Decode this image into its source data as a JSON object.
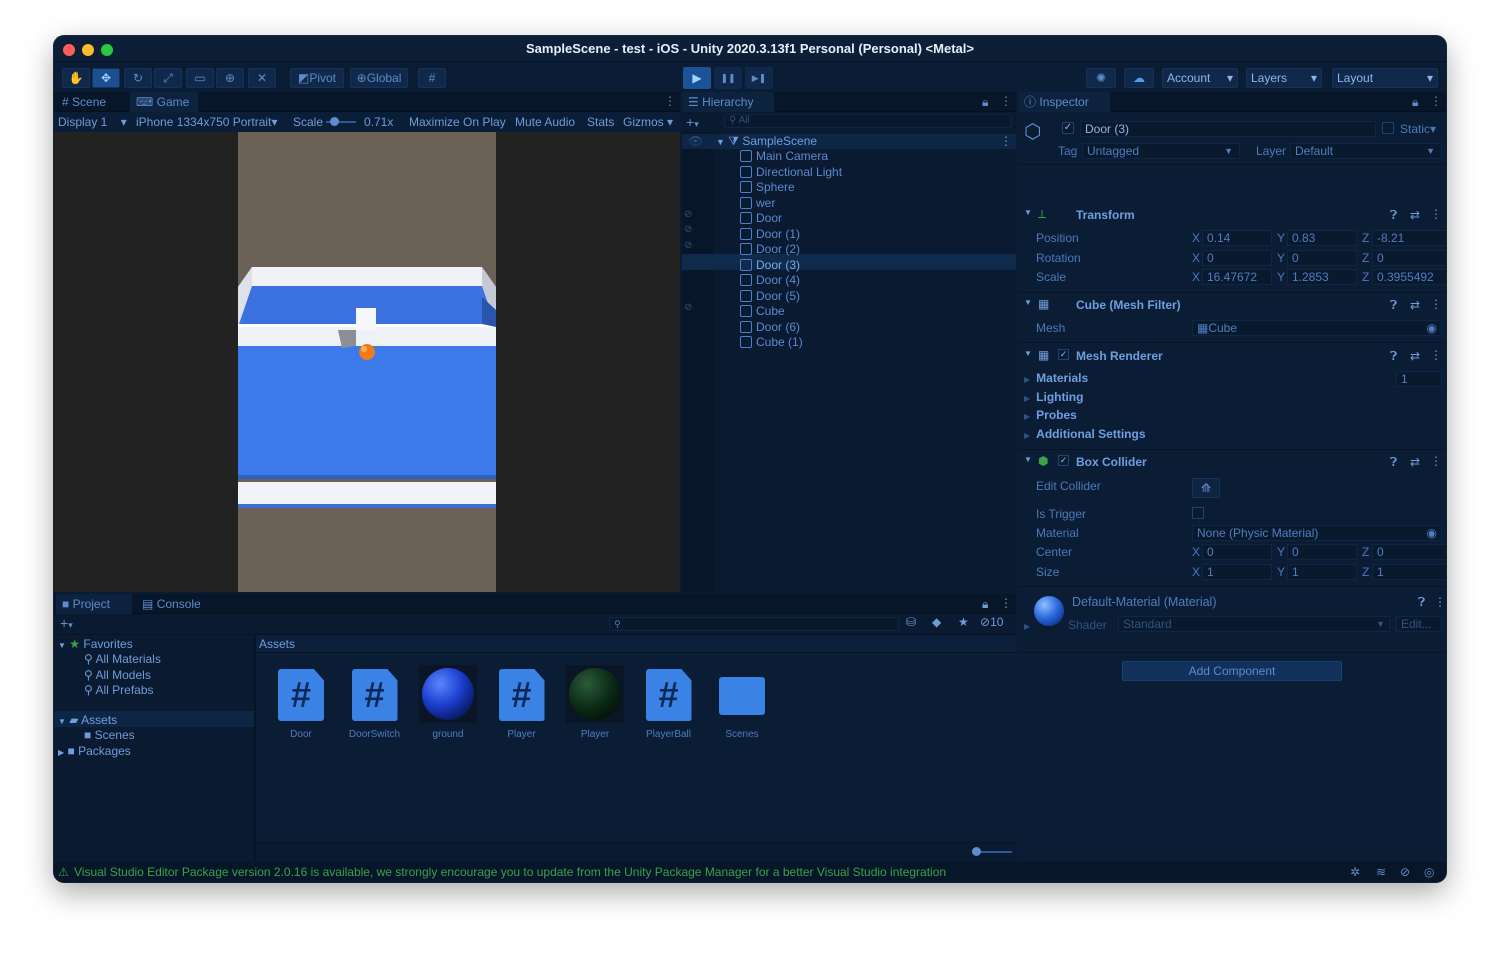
{
  "window": {
    "title": "SampleScene - test - iOS - Unity 2020.3.13f1 Personal (Personal) <Metal>",
    "colors": {
      "close": "#ff5f57",
      "minimize": "#febc2e",
      "zoom": "#28c840"
    }
  },
  "toolbar": {
    "pivot_label": "Pivot",
    "global_label": "Global",
    "account_label": "Account",
    "layers_label": "Layers",
    "layout_label": "Layout"
  },
  "game_view": {
    "tab_scene": "Scene",
    "tab_game": "Game",
    "display": "Display 1",
    "resolution": "iPhone 1334x750 Portrait",
    "scale_label": "Scale",
    "scale_value": "0.71x",
    "maximize": "Maximize On Play",
    "mute": "Mute Audio",
    "stats": "Stats",
    "gizmos": "Gizmos"
  },
  "hierarchy": {
    "tab": "Hierarchy",
    "search_placeholder": "All",
    "scene": "SampleScene",
    "items": [
      "Main Camera",
      "Directional Light",
      "Sphere",
      "wer",
      "Door",
      "Door (1)",
      "Door (2)",
      "Door (3)",
      "Door (4)",
      "Door (5)",
      "Cube",
      "Door (6)",
      "Cube (1)"
    ],
    "selected_index": 7
  },
  "inspector": {
    "tab": "Inspector",
    "object_name": "Door (3)",
    "static_label": "Static",
    "tag_label": "Tag",
    "tag_value": "Untagged",
    "layer_label": "Layer",
    "layer_value": "Default",
    "transform": {
      "title": "Transform",
      "position_label": "Position",
      "rotation_label": "Rotation",
      "scale_label": "Scale",
      "position": {
        "x": "0.14",
        "y": "0.83",
        "z": "-8.21"
      },
      "rotation": {
        "x": "0",
        "y": "0",
        "z": "0"
      },
      "scale": {
        "x": "16.47672",
        "y": "1.2853",
        "z": "0.3955492"
      }
    },
    "mesh_filter": {
      "title": "Cube (Mesh Filter)",
      "mesh_label": "Mesh",
      "mesh_value": "Cube"
    },
    "mesh_renderer": {
      "title": "Mesh Renderer",
      "sections": [
        "Materials",
        "Lighting",
        "Probes",
        "Additional Settings"
      ],
      "materials_count": "1"
    },
    "box_collider": {
      "title": "Box Collider",
      "edit_label": "Edit Collider",
      "trigger_label": "Is Trigger",
      "material_label": "Material",
      "material_value": "None (Physic Material)",
      "center_label": "Center",
      "size_label": "Size",
      "center": {
        "x": "0",
        "y": "0",
        "z": "0"
      },
      "size": {
        "x": "1",
        "y": "1",
        "z": "1"
      }
    },
    "material": {
      "title": "Default-Material (Material)",
      "shader_label": "Shader",
      "shader_value": "Standard",
      "edit_label": "Edit..."
    },
    "add_component": "Add Component",
    "axis_x": "X",
    "axis_y": "Y",
    "axis_z": "Z"
  },
  "project": {
    "tab_project": "Project",
    "tab_console": "Console",
    "hidden_count": "10",
    "favorites": "Favorites",
    "fav_items": [
      "All Materials",
      "All Models",
      "All Prefabs"
    ],
    "assets": "Assets",
    "scenes": "Scenes",
    "packages": "Packages",
    "breadcrumb": "Assets",
    "asset_items": [
      {
        "name": "Door",
        "kind": "script"
      },
      {
        "name": "DoorSwitch",
        "kind": "script"
      },
      {
        "name": "ground",
        "kind": "material-blue"
      },
      {
        "name": "Player",
        "kind": "script"
      },
      {
        "name": "Player",
        "kind": "material-dark"
      },
      {
        "name": "PlayerBall",
        "kind": "script"
      },
      {
        "name": "Scenes",
        "kind": "folder"
      }
    ]
  },
  "status": {
    "message": "Visual Studio Editor Package version 2.0.16 is available, we strongly encourage you to update from the Unity Package Manager for a better Visual Studio integration"
  },
  "glyphs": {
    "hash": "#",
    "check": "✓",
    "play": "▶",
    "pause": "❚❚",
    "step": "▶❚",
    "plus": "+",
    "warn": "⚠"
  }
}
